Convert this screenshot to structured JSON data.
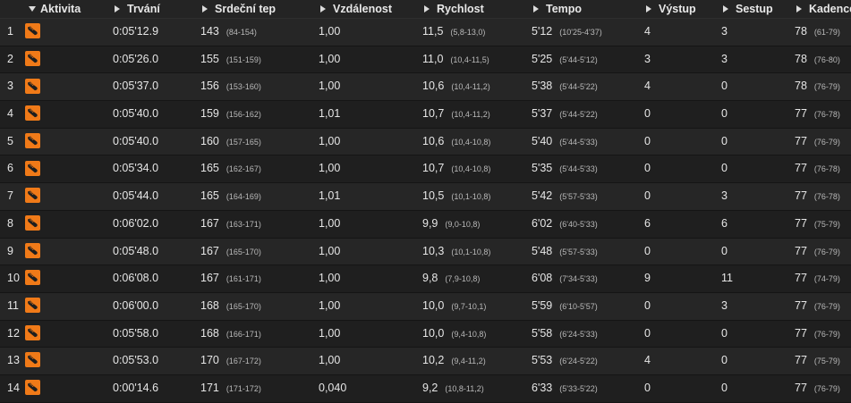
{
  "columns": {
    "activity": "Aktivita",
    "duration": "Trvání",
    "heart_rate": "Srdeční tep",
    "distance": "Vzdálenost",
    "speed": "Rychlost",
    "pace": "Tempo",
    "ascent": "Výstup",
    "descent": "Sestup",
    "cadence": "Kadence"
  },
  "activity_icon": "running-shoe-icon",
  "accent_color": "#f07a18",
  "laps": [
    {
      "n": "1",
      "duration": "0:05'12.9",
      "hr": "143",
      "hr_range": "(84-154)",
      "distance": "1,00",
      "speed": "11,5",
      "speed_range": "(5,8-13,0)",
      "pace": "5'12",
      "pace_range": "(10'25-4'37)",
      "ascent": "4",
      "descent": "3",
      "cadence": "78",
      "cadence_range": "(61-79)"
    },
    {
      "n": "2",
      "duration": "0:05'26.0",
      "hr": "155",
      "hr_range": "(151-159)",
      "distance": "1,00",
      "speed": "11,0",
      "speed_range": "(10,4-11,5)",
      "pace": "5'25",
      "pace_range": "(5'44-5'12)",
      "ascent": "3",
      "descent": "3",
      "cadence": "78",
      "cadence_range": "(76-80)"
    },
    {
      "n": "3",
      "duration": "0:05'37.0",
      "hr": "156",
      "hr_range": "(153-160)",
      "distance": "1,00",
      "speed": "10,6",
      "speed_range": "(10,4-11,2)",
      "pace": "5'38",
      "pace_range": "(5'44-5'22)",
      "ascent": "4",
      "descent": "0",
      "cadence": "78",
      "cadence_range": "(76-79)"
    },
    {
      "n": "4",
      "duration": "0:05'40.0",
      "hr": "159",
      "hr_range": "(156-162)",
      "distance": "1,01",
      "speed": "10,7",
      "speed_range": "(10,4-11,2)",
      "pace": "5'37",
      "pace_range": "(5'44-5'22)",
      "ascent": "0",
      "descent": "0",
      "cadence": "77",
      "cadence_range": "(76-78)"
    },
    {
      "n": "5",
      "duration": "0:05'40.0",
      "hr": "160",
      "hr_range": "(157-165)",
      "distance": "1,00",
      "speed": "10,6",
      "speed_range": "(10,4-10,8)",
      "pace": "5'40",
      "pace_range": "(5'44-5'33)",
      "ascent": "0",
      "descent": "0",
      "cadence": "77",
      "cadence_range": "(76-79)"
    },
    {
      "n": "6",
      "duration": "0:05'34.0",
      "hr": "165",
      "hr_range": "(162-167)",
      "distance": "1,00",
      "speed": "10,7",
      "speed_range": "(10,4-10,8)",
      "pace": "5'35",
      "pace_range": "(5'44-5'33)",
      "ascent": "0",
      "descent": "0",
      "cadence": "77",
      "cadence_range": "(76-78)"
    },
    {
      "n": "7",
      "duration": "0:05'44.0",
      "hr": "165",
      "hr_range": "(164-169)",
      "distance": "1,01",
      "speed": "10,5",
      "speed_range": "(10,1-10,8)",
      "pace": "5'42",
      "pace_range": "(5'57-5'33)",
      "ascent": "0",
      "descent": "3",
      "cadence": "77",
      "cadence_range": "(76-78)"
    },
    {
      "n": "8",
      "duration": "0:06'02.0",
      "hr": "167",
      "hr_range": "(163-171)",
      "distance": "1,00",
      "speed": "9,9",
      "speed_range": "(9,0-10,8)",
      "pace": "6'02",
      "pace_range": "(6'40-5'33)",
      "ascent": "6",
      "descent": "6",
      "cadence": "77",
      "cadence_range": "(75-79)"
    },
    {
      "n": "9",
      "duration": "0:05'48.0",
      "hr": "167",
      "hr_range": "(165-170)",
      "distance": "1,00",
      "speed": "10,3",
      "speed_range": "(10,1-10,8)",
      "pace": "5'48",
      "pace_range": "(5'57-5'33)",
      "ascent": "0",
      "descent": "0",
      "cadence": "77",
      "cadence_range": "(76-79)"
    },
    {
      "n": "10",
      "duration": "0:06'08.0",
      "hr": "167",
      "hr_range": "(161-171)",
      "distance": "1,00",
      "speed": "9,8",
      "speed_range": "(7,9-10,8)",
      "pace": "6'08",
      "pace_range": "(7'34-5'33)",
      "ascent": "9",
      "descent": "11",
      "cadence": "77",
      "cadence_range": "(74-79)"
    },
    {
      "n": "11",
      "duration": "0:06'00.0",
      "hr": "168",
      "hr_range": "(165-170)",
      "distance": "1,00",
      "speed": "10,0",
      "speed_range": "(9,7-10,1)",
      "pace": "5'59",
      "pace_range": "(6'10-5'57)",
      "ascent": "0",
      "descent": "3",
      "cadence": "77",
      "cadence_range": "(76-79)"
    },
    {
      "n": "12",
      "duration": "0:05'58.0",
      "hr": "168",
      "hr_range": "(166-171)",
      "distance": "1,00",
      "speed": "10,0",
      "speed_range": "(9,4-10,8)",
      "pace": "5'58",
      "pace_range": "(6'24-5'33)",
      "ascent": "0",
      "descent": "0",
      "cadence": "77",
      "cadence_range": "(76-79)"
    },
    {
      "n": "13",
      "duration": "0:05'53.0",
      "hr": "170",
      "hr_range": "(167-172)",
      "distance": "1,00",
      "speed": "10,2",
      "speed_range": "(9,4-11,2)",
      "pace": "5'53",
      "pace_range": "(6'24-5'22)",
      "ascent": "4",
      "descent": "0",
      "cadence": "77",
      "cadence_range": "(75-79)"
    },
    {
      "n": "14",
      "duration": "0:00'14.6",
      "hr": "171",
      "hr_range": "(171-172)",
      "distance": "0,040",
      "speed": "9,2",
      "speed_range": "(10,8-11,2)",
      "pace": "6'33",
      "pace_range": "(5'33-5'22)",
      "ascent": "0",
      "descent": "0",
      "cadence": "77",
      "cadence_range": "(76-79)"
    }
  ]
}
